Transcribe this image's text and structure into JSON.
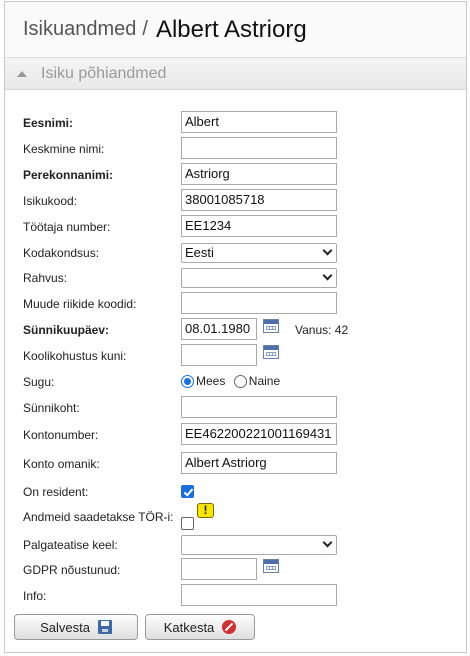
{
  "header": {
    "breadcrumb": "Isikuandmed",
    "separator": "/",
    "person_name": "Albert Astriorg"
  },
  "section": {
    "title": "Isiku põhiandmed"
  },
  "fields": {
    "eesnimi": {
      "label": "Eesnimi:",
      "value": "Albert"
    },
    "keskmine_nimi": {
      "label": "Keskmine nimi:",
      "value": ""
    },
    "perekonnanimi": {
      "label": "Perekonnanimi:",
      "value": "Astriorg"
    },
    "isikukood": {
      "label": "Isikukood:",
      "value": "38001085718"
    },
    "tootaja_number": {
      "label": "Töötaja number:",
      "value": "EE1234"
    },
    "kodakondsus": {
      "label": "Kodakondsus:",
      "value": "Eesti"
    },
    "rahvus": {
      "label": "Rahvus:",
      "value": ""
    },
    "muude_riikide_koodid": {
      "label": "Muude riikide koodid:",
      "value": ""
    },
    "synnikuupaev": {
      "label": "Sünnikuupäev:",
      "value": "08.01.1980",
      "age_text": "Vanus: 42"
    },
    "koolikohustus": {
      "label": "Koolikohustus kuni:",
      "value": ""
    },
    "sugu": {
      "label": "Sugu:",
      "options": [
        "Mees",
        "Naine"
      ],
      "selected": "Mees"
    },
    "synnikoht": {
      "label": "Sünnikoht:",
      "value": ""
    },
    "kontonumber": {
      "label": "Kontonumber:",
      "value": "EE462200221001169431"
    },
    "konto_omanik": {
      "label": "Konto omanik:",
      "value": "Albert Astriorg"
    },
    "on_resident": {
      "label": "On resident:",
      "checked": true
    },
    "tor": {
      "label": "Andmeid saadetakse TÖR-i:",
      "checked": false,
      "warning": "!"
    },
    "palgateatise_keel": {
      "label": "Palgateatise keel:",
      "value": ""
    },
    "gdpr": {
      "label": "GDPR nõustunud:",
      "value": ""
    },
    "info": {
      "label": "Info:",
      "value": ""
    }
  },
  "buttons": {
    "save": "Salvesta",
    "cancel": "Katkesta"
  },
  "colors": {
    "accent": "#1a6fe0",
    "warning": "#f5e600",
    "cancel_icon": "#d23030",
    "save_icon": "#3f6aa8"
  }
}
